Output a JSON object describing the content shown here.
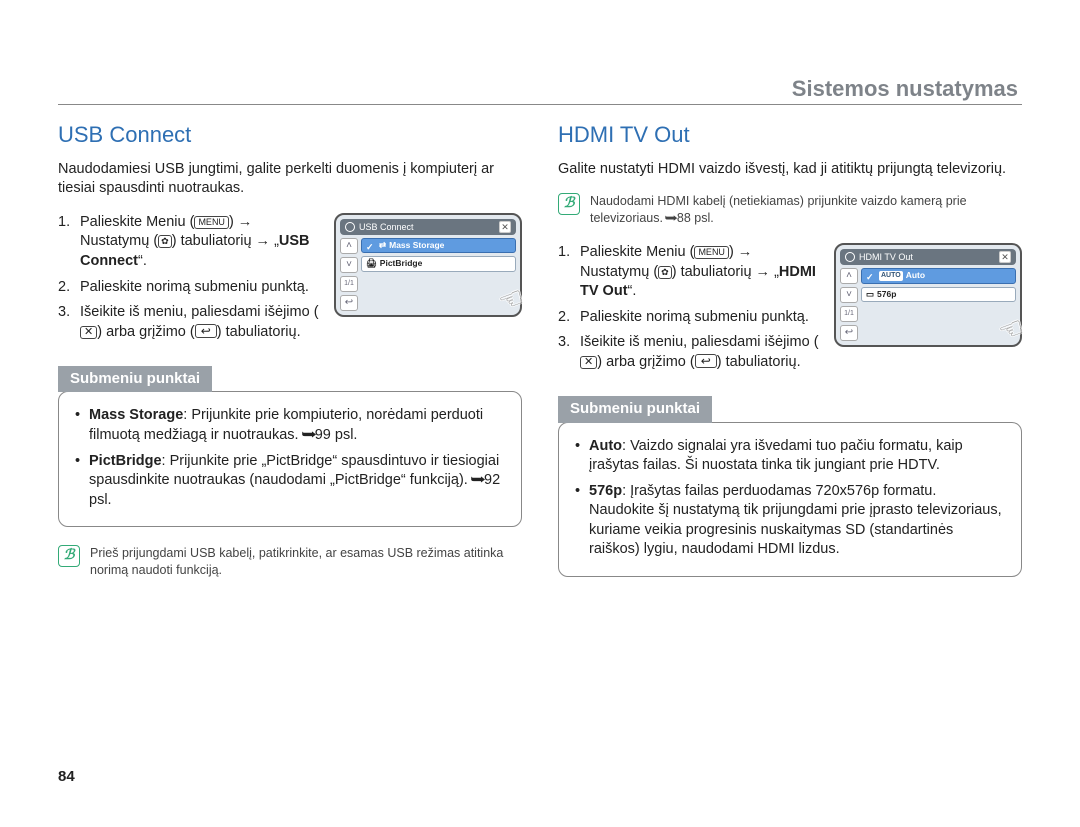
{
  "header": {
    "title": "Sistemos nustatymas"
  },
  "page_number": "84",
  "icons": {
    "menu": "MENU",
    "arrow": "→",
    "close": "✕",
    "return": "↩",
    "page_arrow": "➥"
  },
  "left": {
    "heading": "USB Connect",
    "intro": "Naudodamiesi USB jungtimi, galite perkelti duomenis į kompiuterį ar tiesiai spausdinti nuotraukas.",
    "step1_a": "Palieskite Meniu (",
    "step1_b": ") ",
    "step1_c": " Nustatymų (",
    "step1_d": ") tabuliatorių ",
    "step1_e": " „",
    "step1_bold": "USB Connect",
    "step1_f": "“.",
    "step2": "Palieskite norimą submeniu punktą.",
    "step3_a": "Išeikite iš meniu, paliesdami išėjimo (",
    "step3_b": ") arba grįžimo (",
    "step3_c": ") tabuliatorių.",
    "figure": {
      "title": "USB Connect",
      "item1": "Mass Storage",
      "item2": "PictBridge"
    },
    "submenu_label": "Submeniu punktai",
    "items": [
      {
        "name": "Mass Storage",
        "text_a": ": Prijunkite prie kompiuterio, norėdami perduoti filmuotą medžiagą ir nuotraukas. ",
        "pg": "99 psl."
      },
      {
        "name": "PictBridge",
        "text_a": ": Prijunkite prie „PictBridge“ spausdintuvo ir tiesiogiai spausdinkite nuotraukas (naudodami „PictBridge“ funkciją). ",
        "pg": "92 psl."
      }
    ],
    "note": "Prieš prijungdami USB kabelį, patikrinkite, ar esamas USB režimas atitinka norimą naudoti funkciją."
  },
  "right": {
    "heading": "HDMI TV Out",
    "intro": "Galite nustatyti HDMI vaizdo išvestį, kad ji atitiktų prijungtą televizorių.",
    "note_a": "Naudodami HDMI kabelį (netiekiamas) prijunkite vaizdo kamerą prie televizoriaus. ",
    "note_pg": "88 psl.",
    "step1_a": "Palieskite Meniu (",
    "step1_b": ") ",
    "step1_c": " Nustatymų (",
    "step1_d": ") tabuliatorių ",
    "step1_e": " „",
    "step1_bold": "HDMI TV Out",
    "step1_f": "“.",
    "step2": "Palieskite norimą submeniu punktą.",
    "step3_a": "Išeikite iš meniu, paliesdami išėjimo (",
    "step3_b": ") arba grįžimo (",
    "step3_c": ") tabuliatorių.",
    "figure": {
      "title": "HDMI TV Out",
      "item1": "Auto",
      "item2": "576p"
    },
    "submenu_label": "Submeniu punktai",
    "items": [
      {
        "name": "Auto",
        "text": ": Vaizdo signalai yra išvedami tuo pačiu formatu, kaip įrašytas failas. Ši nuostata tinka tik jungiant prie HDTV."
      },
      {
        "name": "576p",
        "text": ": Įrašytas failas perduodamas 720x576p formatu. Naudokite šį nustatymą tik prijungdami prie įprasto televizoriaus, kuriame veikia progresinis nuskaitymas SD (standartinės raiškos) lygiu, naudodami HDMI lizdus."
      }
    ]
  }
}
